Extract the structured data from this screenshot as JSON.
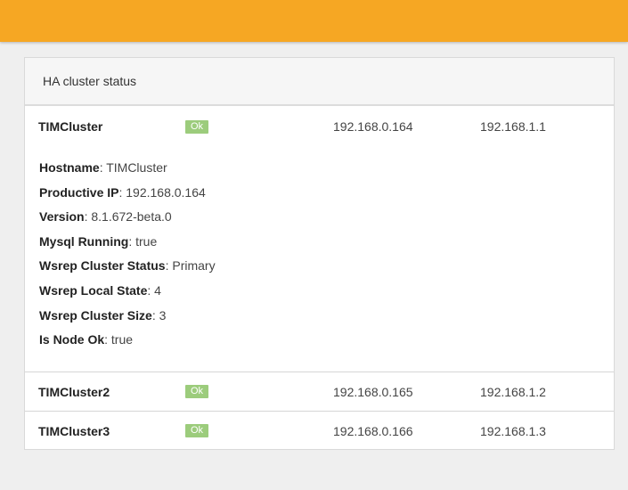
{
  "header": {
    "bar_color": "#f6a723"
  },
  "panel": {
    "title": "HA cluster status"
  },
  "nodes": [
    {
      "name": "TIMCluster",
      "status": "Ok",
      "ip_primary": "192.168.0.164",
      "ip_secondary": "192.168.1.1",
      "details": [
        {
          "label": "Hostname",
          "value": ": TIMCluster"
        },
        {
          "label": "Productive IP",
          "value": ": 192.168.0.164"
        },
        {
          "label": "Version",
          "value": ": 8.1.672-beta.0"
        },
        {
          "label": "Mysql Running",
          "value": ": true"
        },
        {
          "label": "Wsrep Cluster Status",
          "value": ": Primary"
        },
        {
          "label": "Wsrep Local State",
          "value": ": 4"
        },
        {
          "label": "Wsrep Cluster Size",
          "value": ": 3"
        },
        {
          "label": "Is Node Ok",
          "value": ": true"
        }
      ]
    },
    {
      "name": "TIMCluster2",
      "status": "Ok",
      "ip_primary": "192.168.0.165",
      "ip_secondary": "192.168.1.2"
    },
    {
      "name": "TIMCluster3",
      "status": "Ok",
      "ip_primary": "192.168.0.166",
      "ip_secondary": "192.168.1.3"
    }
  ],
  "colors": {
    "status_ok": "#9ccc7c",
    "page_background": "#efefef"
  }
}
